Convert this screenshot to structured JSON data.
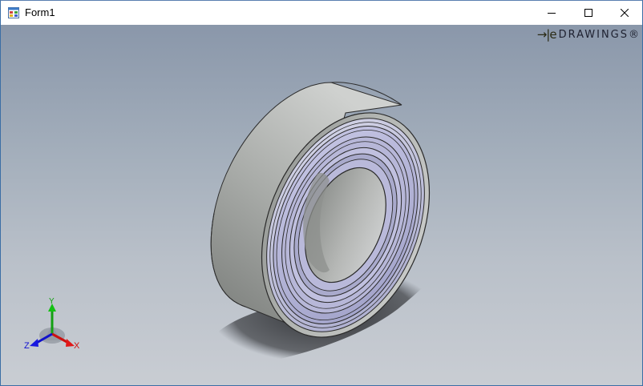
{
  "window": {
    "title": "Form1",
    "controls": {
      "minimize_icon": "minimize-icon",
      "maximize_icon": "maximize-icon",
      "close_icon": "close-icon"
    }
  },
  "viewer": {
    "logo": {
      "mark": "→|e",
      "text": "DRAWINGS®"
    },
    "triad": {
      "x_label": "X",
      "y_label": "Y",
      "z_label": "Z"
    },
    "colors": {
      "background_top": "#8a97aa",
      "background_bottom": "#c9cdd3",
      "outer_ring": "#a9aca8",
      "shield": "#b8b8d8",
      "x_axis": "#d01010",
      "y_axis": "#10a010",
      "z_axis": "#1010d0"
    }
  }
}
